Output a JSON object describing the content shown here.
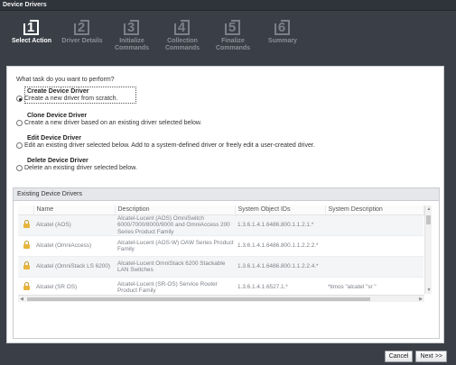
{
  "window": {
    "title": "Device Drivers"
  },
  "steps": [
    {
      "num": "1",
      "label": "Select Action",
      "label2": ""
    },
    {
      "num": "2",
      "label": "Driver Details",
      "label2": ""
    },
    {
      "num": "3",
      "label": "Initialize",
      "label2": "Commands"
    },
    {
      "num": "4",
      "label": "Collection",
      "label2": "Commands"
    },
    {
      "num": "5",
      "label": "Finalize",
      "label2": "Commands"
    },
    {
      "num": "6",
      "label": "Summary",
      "label2": ""
    }
  ],
  "task": {
    "question": "What task do you want to perform?",
    "options": [
      {
        "title": "Create Device Driver",
        "desc": "Create a new driver from scratch.",
        "selected": true
      },
      {
        "title": "Clone Device Driver",
        "desc": "Create a new driver based on an existing driver selected below.",
        "selected": false
      },
      {
        "title": "Edit Device Driver",
        "desc": "Edit an existing driver selected below. Add to a system-defined driver or freely edit a user-created driver.",
        "selected": false
      },
      {
        "title": "Delete Device Driver",
        "desc": "Delete an existing driver selected below.",
        "selected": false
      }
    ]
  },
  "drivers": {
    "header": "Existing Device Drivers",
    "columns": [
      "",
      "Name",
      "Description",
      "System Object IDs",
      "System Description"
    ],
    "rows": [
      {
        "icon": "lock-icon",
        "name": "Alcatel (AOS)",
        "description": "Alcatel-Lucent (AOS) OmniSwitch 6000/7000/8000/9000 and OmniAccess 200 Series Product Family",
        "oids": "1.3.6.1.4.1.6486.800.1.1.2.1.*",
        "sysdesc": ""
      },
      {
        "icon": "lock-icon",
        "name": "Alcatel (OmniAccess)",
        "description": "Alcatel-Lucent (AOS-W) OAW Series Product Family",
        "oids": "1.3.6.1.4.1.6486.800.1.1.2.2.2.*",
        "sysdesc": ""
      },
      {
        "icon": "lock-icon",
        "name": "Alcatel (OmniStack LS 6200)",
        "description": "Alcatel-Lucent OmniStack 6200 Stackable LAN Switches",
        "oids": "1.3.6.1.4.1.6486.800.1.1.2.2.4.*",
        "sysdesc": ""
      },
      {
        "icon": "lock-icon",
        "name": "Alcatel (SR OS)",
        "description": "Alcatel-Lucent (SR-OS) Service Router Product Family",
        "oids": "1.3.6.1.4.1.6527.1.*",
        "sysdesc": "*timos \"alcatel \"sr \""
      }
    ]
  },
  "buttons": {
    "cancel": "Cancel",
    "next": "Next >>"
  }
}
